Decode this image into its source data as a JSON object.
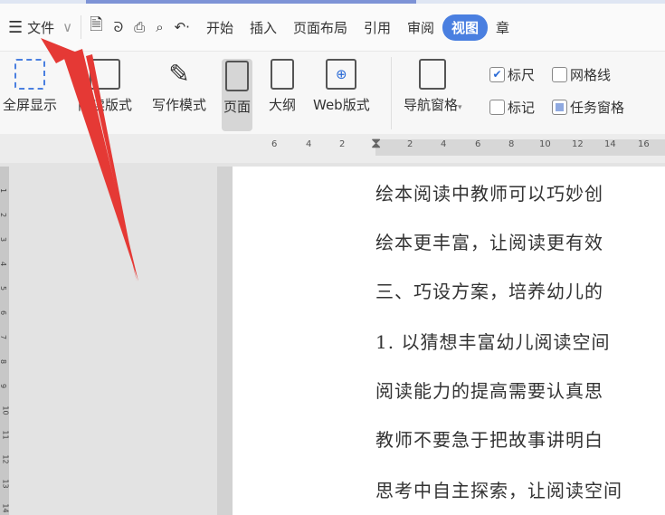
{
  "menu": {
    "file": "文件",
    "tabs": [
      "开始",
      "插入",
      "页面布局",
      "引用",
      "审阅",
      "视图",
      "章"
    ],
    "active_tab": "视图"
  },
  "ribbon": {
    "tools": [
      "全屏显示",
      "阅读版式",
      "写作模式",
      "页面",
      "大纲",
      "Web版式"
    ],
    "active_tool": "页面",
    "nav_pane": "导航窗格",
    "checks": [
      {
        "label": "标尺",
        "checked": true
      },
      {
        "label": "网格线",
        "checked": false
      },
      {
        "label": "标记",
        "checked": false
      },
      {
        "label": "任务窗格",
        "checked": true
      }
    ]
  },
  "ruler": {
    "left": [
      "6",
      "4",
      "2"
    ],
    "right": [
      "2",
      "4",
      "6",
      "8",
      "10",
      "12",
      "14",
      "16"
    ]
  },
  "vruler": [
    "1",
    "2",
    "3",
    "4",
    "5",
    "6",
    "7",
    "8",
    "9",
    "10",
    "11",
    "12",
    "13",
    "14"
  ],
  "document": {
    "lines": [
      "绘本阅读中教师可以巧妙创",
      "绘本更丰富，让阅读更有效",
      "三、巧设方案，培养幼儿的",
      "1. 以猜想丰富幼儿阅读空间",
      "阅读能力的提高需要认真思",
      "教师不要急于把故事讲明白",
      "思考中自主探索，让阅读空间"
    ]
  },
  "colors": {
    "accent": "#4a7fe0",
    "arrow": "#e53935"
  }
}
